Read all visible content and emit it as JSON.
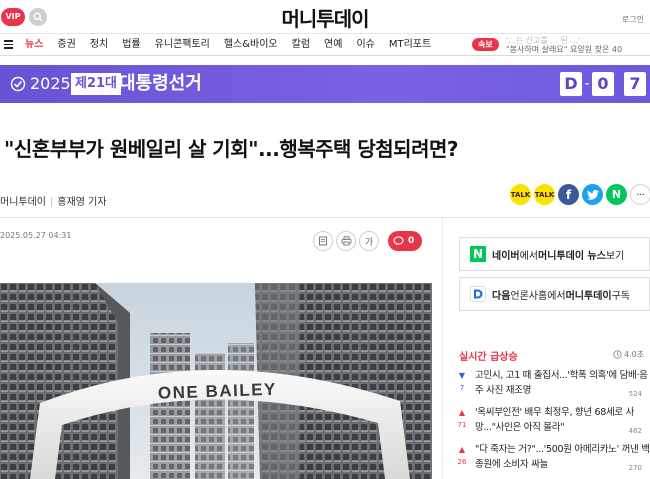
{
  "topbar": {
    "vip_label": "VIP",
    "logo": "머니투데이",
    "login": "로그인"
  },
  "nav": {
    "items": [
      "뉴스",
      "증권",
      "정치",
      "법률",
      "유니콘팩토리",
      "헬스&바이오",
      "칼럼",
      "연예",
      "이슈",
      "MT리포트"
    ],
    "active_index": 0,
    "breaking_label": "속보",
    "ticker_line1": "'...는 신고를 ... 된 ...' ...",
    "ticker_line2": "\"봉사하며 살래요\" 요양원 찾은 40"
  },
  "banner": {
    "year": "2025",
    "round": "제21대",
    "title": "대통령선거",
    "dday": [
      "D",
      "0",
      "7"
    ],
    "background": "#6a52d4"
  },
  "article": {
    "headline": "\"신혼부부가 원베일리 살 기회\"...행복주택 당첨되려면?",
    "source": "머니투데이",
    "reporter": "홍재영 기자",
    "date": "2025.05.27 04:31",
    "comment_count": "0",
    "photo_sign": "ONE BAILEY"
  },
  "share": {
    "talk_label": "TALK",
    "story_label": "TALK",
    "facebook_label": "f",
    "naver_label": "N",
    "more_label": "···"
  },
  "tools": {
    "font_label": "가"
  },
  "sidebar": {
    "naver_badge": "N",
    "naver_text_pre": "네이버",
    "naver_text_mid": "에서 ",
    "naver_text_bold": "머니투데이 뉴스",
    "naver_text_post": " 보기",
    "daum_text_pre": "다음",
    "daum_text_mid": "언론사홈에서 ",
    "daum_text_bold": "머니투데이",
    "daum_text_post": " 구독",
    "realtime_title": "실시간 급상승",
    "realtime_time": "4.0초",
    "items": [
      {
        "text": "고민시, 고1 때 출집서...'학폭 의혹'에 담배·음주 사진 재조명",
        "views": "524",
        "rank": "7",
        "direction": "down"
      },
      {
        "text": "'옥씨부인전' 배우 최정우, 향년 68세로 사망...\"사인은 아직 몰라\"",
        "views": "462",
        "rank": "71",
        "direction": "up"
      },
      {
        "text": "\"다 죽자는 거?\"...'500원 아메리카노' 꺼낸 백종원에 소비자 싸늘",
        "views": "270",
        "rank": "26",
        "direction": "up"
      }
    ]
  },
  "colors": {
    "accent": "#e8354a",
    "banner": "#6a52d4",
    "naver": "#03c75a",
    "facebook": "#3b5998",
    "twitter": "#1da1f2"
  }
}
